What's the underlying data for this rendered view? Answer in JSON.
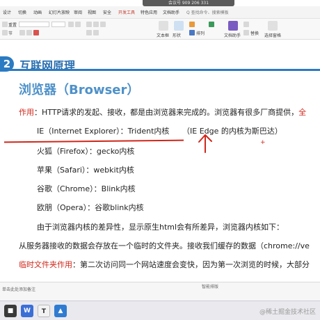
{
  "titlebar": {
    "meeting_badge": "会议号 909 206 331"
  },
  "menu": {
    "items": [
      "设计",
      "切换",
      "动画",
      "幻灯片放映",
      "审阅",
      "视图",
      "安全",
      "开发工具",
      "特色应用",
      "文档助手"
    ],
    "active_index": 7
  },
  "ribbon": {
    "reset": "重置",
    "section": "节",
    "textbox": "文本框",
    "shape": "形状",
    "arrange": "排列",
    "doc_helper": "文档助手",
    "select_pane": "选择窗格",
    "replace": "替换"
  },
  "slide": {
    "section_number": "2",
    "section_title": "互联网原理",
    "title": "浏览器（Browser）",
    "intro_label": "作用",
    "intro_text": "：HTTP请求的发起、接收，都是由浏览器来完成的。浏览器有很多厂商提供，",
    "intro_tail": "全",
    "browsers": [
      "IE（Internet Explorer）：Trident内核",
      "火狐（Firefox）：gecko内核",
      "苹果（Safari）：webkit内核",
      "谷歌（Chrome）：Blink内核",
      "欧朋（Opera）：谷歌blink内核"
    ],
    "annotation": "（IE Edge 的内核为斯巴达）",
    "diff_text": "由于浏览器内核的差异性，显示原生html会有所差异，浏览器内核如下：",
    "cache_text": "从服务器接收的数据会存放在一个临时的文件夹。接收我们缓存的数据（chrome://ve",
    "temp_label": "临时文件夹作用",
    "temp_text": "：第二次访问同一个网站速度会变快，因为第一次浏览的时候，大部分"
  },
  "notes": {
    "text": "单击此处添加备注",
    "smart_layout": "智能排版"
  },
  "taskbar": {
    "icons": [
      "start-icon",
      "wps-icon",
      "word-icon",
      "app-icon"
    ],
    "watermark": "@稀土掘金技术社区"
  },
  "colors": {
    "accent": "#2b7bc2",
    "red": "#d0261a",
    "title_blue": "#4e91c9"
  }
}
